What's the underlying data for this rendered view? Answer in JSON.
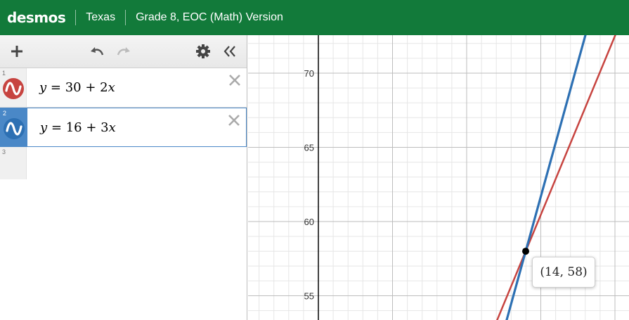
{
  "header": {
    "logo": "desmos",
    "state": "Texas",
    "version": "Grade 8, EOC (Math) Version"
  },
  "toolbar": {
    "add_icon": "plus-icon",
    "undo_icon": "undo-icon",
    "redo_icon": "redo-icon",
    "settings_icon": "gear-icon",
    "collapse_icon": "double-chevron-left-icon"
  },
  "expressions": [
    {
      "index": "1",
      "latex_y": "y",
      "eq": " = 30 + 2",
      "var": "x",
      "color": "#c74440",
      "active": false
    },
    {
      "index": "2",
      "latex_y": "y",
      "eq": " = 16 + 3",
      "var": "x",
      "color": "#2d70b3",
      "active": true
    }
  ],
  "empty_row_index": "3",
  "graph": {
    "y_ticks": [
      "70",
      "65",
      "60",
      "55"
    ],
    "intersection_label": "(14, 58)",
    "colors": {
      "red": "#c74440",
      "blue": "#2d70b3",
      "grid_minor": "#e6e6e6",
      "grid_major": "#bdbdbd",
      "axis": "#000000"
    }
  }
}
